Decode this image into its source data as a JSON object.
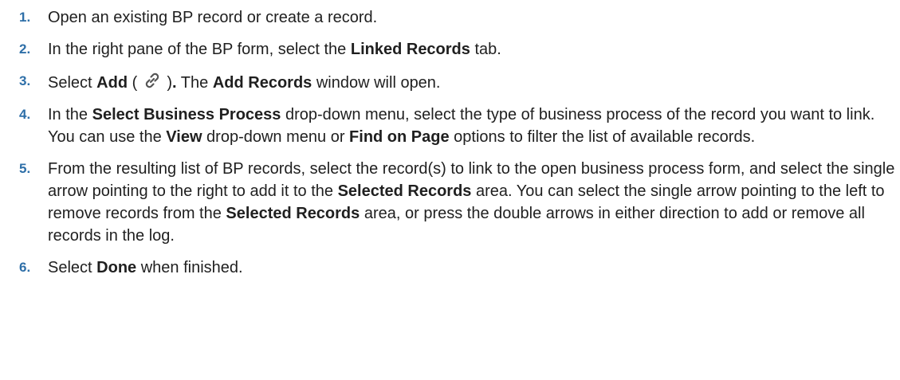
{
  "steps": [
    {
      "num": "1.",
      "parts": [
        {
          "t": "Open an existing BP record or create a record."
        }
      ]
    },
    {
      "num": "2.",
      "parts": [
        {
          "t": "In the right pane of the BP form, select the "
        },
        {
          "t": "Linked Records",
          "b": true
        },
        {
          "t": " tab."
        }
      ]
    },
    {
      "num": "3.",
      "parts": [
        {
          "t": "Select "
        },
        {
          "t": "Add",
          "b": true
        },
        {
          "t": " ( "
        },
        {
          "icon": "link-icon"
        },
        {
          "t": " )",
          "b": false
        },
        {
          "t": ".",
          "b": true
        },
        {
          "t": " The "
        },
        {
          "t": "Add Records",
          "b": true
        },
        {
          "t": " window will open."
        }
      ]
    },
    {
      "num": "4.",
      "parts": [
        {
          "t": "In the "
        },
        {
          "t": "Select Business Process",
          "b": true
        },
        {
          "t": " drop-down menu, select the type of business process of the record you want to link. You can use the "
        },
        {
          "t": "View",
          "b": true
        },
        {
          "t": " drop-down menu or "
        },
        {
          "t": "Find on Page",
          "b": true
        },
        {
          "t": " options to filter the list of available records."
        }
      ]
    },
    {
      "num": "5.",
      "parts": [
        {
          "t": "From the resulting list of BP records, select the record(s) to link to the open business process form, and select the single arrow pointing to the right to add it to the "
        },
        {
          "t": "Selected Records",
          "b": true
        },
        {
          "t": " area. You can select the single arrow pointing to the left to remove records from the "
        },
        {
          "t": "Selected Records",
          "b": true
        },
        {
          "t": " area, or press the double arrows in either direction to add or remove all records in the log."
        }
      ]
    },
    {
      "num": "6.",
      "parts": [
        {
          "t": "Select "
        },
        {
          "t": "Done",
          "b": true
        },
        {
          "t": " when finished."
        }
      ]
    }
  ]
}
